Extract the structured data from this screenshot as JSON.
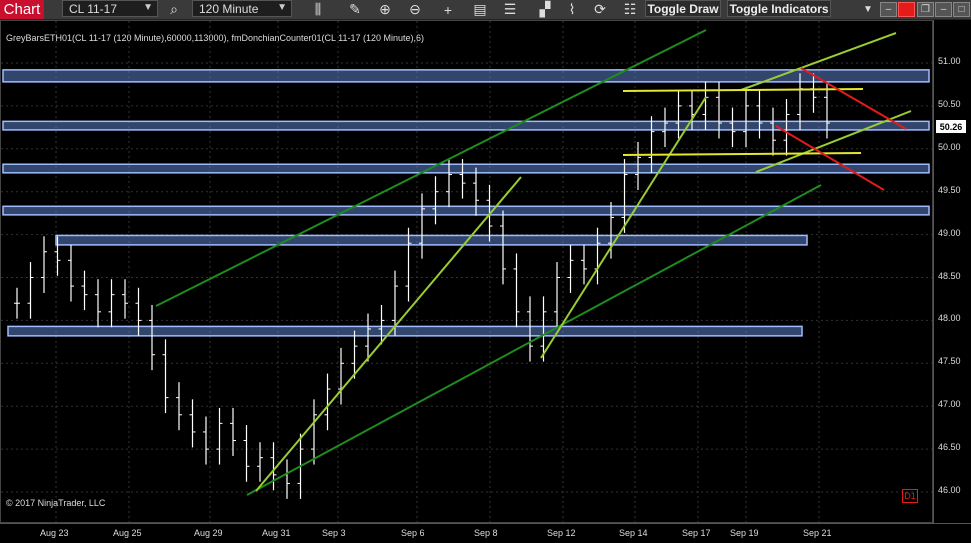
{
  "toolbar": {
    "chart_tab": "Chart",
    "instrument": "CL 11-17",
    "interval": "120 Minute",
    "toggle_draw": "Toggle Draw",
    "toggle_indicators": "Toggle Indicators",
    "icons": [
      "search-icon",
      "bar-chart-icon",
      "pencil-icon",
      "zoom-in-icon",
      "zoom-out-icon",
      "crosshair-icon",
      "data-box-icon",
      "hand-icon",
      "chart-style-icon",
      "drawing-tools-icon",
      "reload-icon",
      "properties-icon"
    ]
  },
  "chart": {
    "indicator_label": "GreyBarsETH01(CL 11-17 (120 Minute),60000,113000), fmDonchianCounter01(CL 11-17 (120 Minute),6)",
    "copyright": "© 2017 NinjaTrader, LLC",
    "d1_badge": "D1",
    "current_price": "50.26",
    "colors": {
      "background": "#000000",
      "zone_fill": "#5b7fc7",
      "zone_border": "#9fbcff",
      "bright_green": "#9acd32",
      "dark_green": "#1e8b1e",
      "yellow": "#e6e62e",
      "red": "#e01b1b",
      "bars": "#ffffff"
    }
  },
  "chart_data": {
    "type": "bar",
    "x_ticks": [
      "Aug 23",
      "Aug 25",
      "Aug 29",
      "Aug 31",
      "Sep 3",
      "Sep 6",
      "Sep 8",
      "Sep 12",
      "Sep 14",
      "Sep 17",
      "Sep 19",
      "Sep 21"
    ],
    "y_ticks": [
      "51.00",
      "50.50",
      "50.00",
      "49.50",
      "49.00",
      "48.50",
      "48.00",
      "47.50",
      "47.00",
      "46.50",
      "46.00"
    ],
    "ylim": [
      45.9,
      51.2
    ],
    "closes": [
      48.2,
      48.5,
      48.8,
      48.7,
      48.4,
      48.3,
      48.1,
      48.3,
      48.2,
      48.0,
      47.6,
      47.1,
      46.9,
      46.7,
      46.5,
      46.8,
      46.6,
      46.3,
      46.4,
      46.2,
      46.1,
      46.5,
      46.9,
      47.2,
      47.5,
      47.7,
      47.9,
      48.0,
      48.4,
      48.9,
      49.3,
      49.5,
      49.7,
      49.6,
      49.4,
      49.1,
      48.6,
      48.1,
      47.7,
      48.1,
      48.5,
      48.7,
      48.6,
      48.9,
      49.2,
      49.7,
      49.9,
      50.2,
      50.3,
      50.5,
      50.4,
      50.6,
      50.3,
      50.2,
      50.5,
      50.3,
      50.1,
      50.4,
      50.7,
      50.6,
      50.3
    ],
    "support_resistance_zones": [
      {
        "low": 50.78,
        "high": 50.92
      },
      {
        "low": 50.22,
        "high": 50.32
      },
      {
        "low": 49.72,
        "high": 49.82
      },
      {
        "low": 49.23,
        "high": 49.33
      },
      {
        "low": 48.88,
        "high": 48.99
      },
      {
        "low": 47.82,
        "high": 47.93
      }
    ]
  }
}
